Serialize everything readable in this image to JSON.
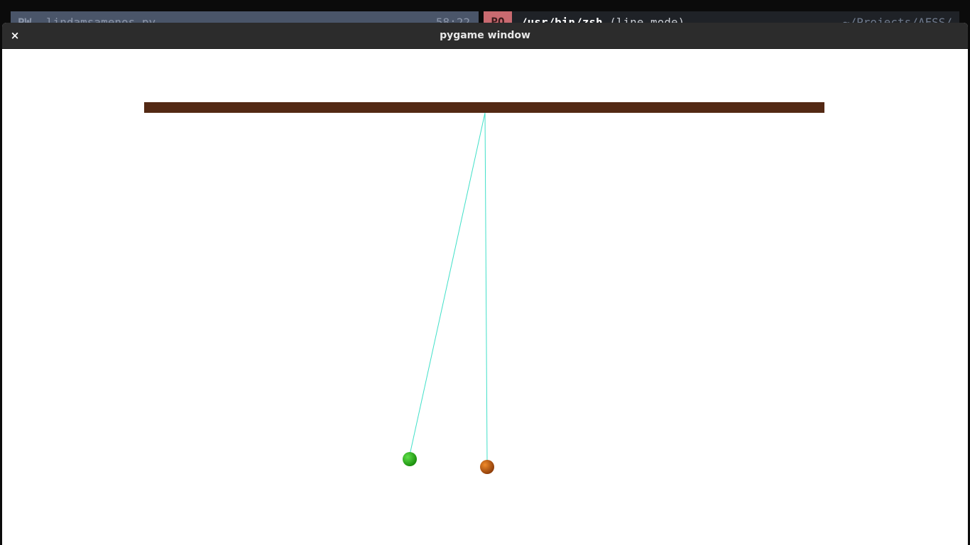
{
  "background_terminal": {
    "left_mode": "PW",
    "left_file": "lindamsamenos.py",
    "left_clock": "58:22",
    "right_tag": "PO",
    "right_command": "/usr/bin/zsh",
    "right_command_suffix": "(line mode)",
    "right_path": "~/Projects/AFSS/"
  },
  "window": {
    "title": "pygame window",
    "close_glyph": "×"
  },
  "scene": {
    "ceiling_color": "#532914",
    "string_color": "#40e0c8",
    "pendulums": [
      {
        "name": "green",
        "color_light": "#5fe04a",
        "color_dark": "#178a0a"
      },
      {
        "name": "orange",
        "color_light": "#f08a2a",
        "color_dark": "#8a3a08"
      }
    ]
  }
}
